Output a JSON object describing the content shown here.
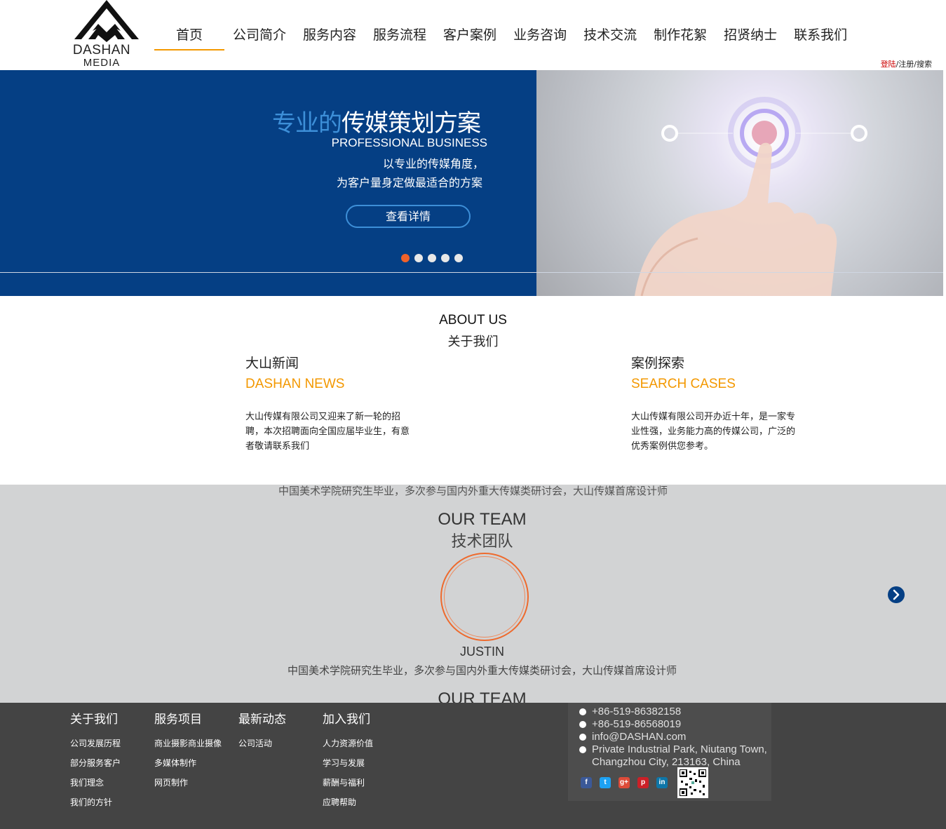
{
  "header": {
    "logo": {
      "name": "DASHAN",
      "sub": "MEDIA"
    },
    "nav": [
      "首页",
      "公司简介",
      "服务内容",
      "服务流程",
      "客户案例",
      "业务咨询",
      "技术交流",
      "制作花絮",
      "招贤纳士",
      "联系我们"
    ],
    "auth": {
      "login": "登陆",
      "register": "/注册",
      "search": "/搜索"
    }
  },
  "banner": {
    "title_highlight": "专业的",
    "title_rest": "传媒策划方案",
    "subtitle": "PROFESSIONAL BUSINESS",
    "line1": "以专业的传媒角度，",
    "line2": "为客户量身定做最适合的方案",
    "button": "查看详情",
    "slides": 5,
    "active_slide": 0
  },
  "about": {
    "title_en": "ABOUT US",
    "title_cn": "关于我们",
    "news": {
      "title_cn": "大山新闻",
      "title_en": "DASHAN NEWS",
      "text": "大山传媒有限公司又迎来了新一轮的招聘，本次招聘面向全国应届毕业生，有意者敬请联系我们"
    },
    "cases": {
      "title_cn": "案例探索",
      "title_en": "SEARCH CASES",
      "text": "大山传媒有限公司开办近十年，是一家专业性强，业务能力高的传媒公司，广泛的优秀案例供您参考。"
    }
  },
  "team": {
    "ghost_top": "中国美术学院研究生毕业，多次参与国内外重大传媒类研讨会，大山传媒首席设计师",
    "title_en": "OUR TEAM",
    "title_cn": "技术团队",
    "member_name": "JUSTIN",
    "member_desc": "中国美术学院研究生毕业，多次参与国内外重大传媒类研讨会，大山传媒首席设计师",
    "ghost_bottom": "OUR TEAM"
  },
  "footer": {
    "columns": [
      {
        "title": "关于我们",
        "items": [
          "公司发展历程",
          "部分服务客户",
          "我们理念",
          "我们的方针"
        ]
      },
      {
        "title": "服务项目",
        "items": [
          "商业摄影商业摄像",
          "多媒体制作",
          "网页制作"
        ]
      },
      {
        "title": "最新动态",
        "items": [
          "公司活动"
        ]
      },
      {
        "title": "加入我们",
        "items": [
          "人力资源价值",
          "学习与发展",
          "薪酬与福利",
          "应聘帮助"
        ]
      }
    ],
    "contact": {
      "phone1": "+86-519-86382158",
      "phone2": "+86-519-86568019",
      "email": "info@DASHAN.com",
      "address1": "Private Industrial Park, Niutang Town,",
      "address2": "Changzhou City, 213163, China"
    },
    "socials": [
      {
        "icon": "facebook-icon",
        "glyph": "f",
        "color": "#3b5998"
      },
      {
        "icon": "twitter-icon",
        "glyph": "t",
        "color": "#1da1f2"
      },
      {
        "icon": "googleplus-icon",
        "glyph": "g+",
        "color": "#dd4b39"
      },
      {
        "icon": "pinterest-icon",
        "glyph": "p",
        "color": "#cb2027"
      },
      {
        "icon": "linkedin-icon",
        "glyph": "in",
        "color": "#0e76a8"
      }
    ]
  },
  "colors": {
    "accent": "#f39800",
    "banner_blue": "#053f84",
    "dot_active": "#f0622a",
    "footer_bg": "#444444"
  }
}
